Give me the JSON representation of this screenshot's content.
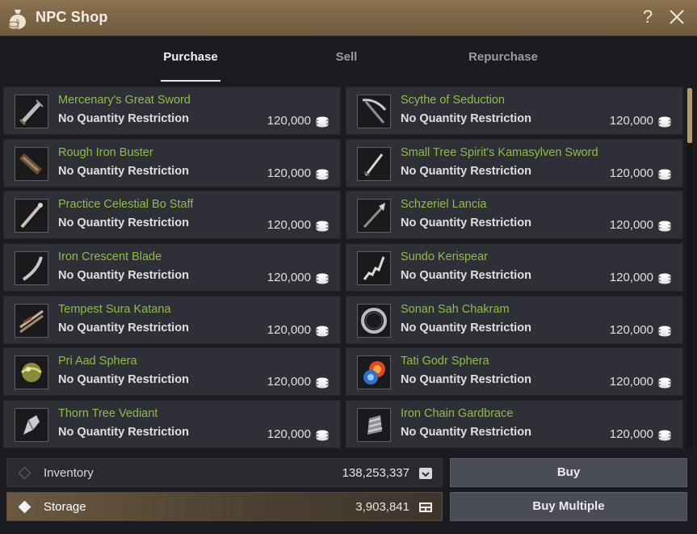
{
  "window": {
    "title": "NPC Shop",
    "help_label": "?"
  },
  "tabs": [
    {
      "label": "Purchase",
      "active": true
    },
    {
      "label": "Sell",
      "active": false
    },
    {
      "label": "Repurchase",
      "active": false
    }
  ],
  "items": [
    {
      "name": "Mercenary's Great Sword",
      "restriction": "No Quantity Restriction",
      "price": "120,000",
      "icon": "great-sword-icon"
    },
    {
      "name": "Scythe of Seduction",
      "restriction": "No Quantity Restriction",
      "price": "120,000",
      "icon": "scythe-icon"
    },
    {
      "name": "Rough Iron Buster",
      "restriction": "No Quantity Restriction",
      "price": "120,000",
      "icon": "buster-icon"
    },
    {
      "name": "Small Tree Spirit's Kamasylven Sword",
      "restriction": "No Quantity Restriction",
      "price": "120,000",
      "icon": "kamasylven-sword-icon"
    },
    {
      "name": "Practice Celestial Bo Staff",
      "restriction": "No Quantity Restriction",
      "price": "120,000",
      "icon": "bo-staff-icon"
    },
    {
      "name": "Schzeriel Lancia",
      "restriction": "No Quantity Restriction",
      "price": "120,000",
      "icon": "lancia-icon"
    },
    {
      "name": "Iron Crescent Blade",
      "restriction": "No Quantity Restriction",
      "price": "120,000",
      "icon": "crescent-blade-icon"
    },
    {
      "name": "Sundo Kerispear",
      "restriction": "No Quantity Restriction",
      "price": "120,000",
      "icon": "kerispear-icon"
    },
    {
      "name": "Tempest Sura Katana",
      "restriction": "No Quantity Restriction",
      "price": "120,000",
      "icon": "katana-icon"
    },
    {
      "name": "Sonan Sah Chakram",
      "restriction": "No Quantity Restriction",
      "price": "120,000",
      "icon": "chakram-icon"
    },
    {
      "name": "Pri Aad Sphera",
      "restriction": "No Quantity Restriction",
      "price": "120,000",
      "icon": "sphera-icon"
    },
    {
      "name": "Tati Godr Sphera",
      "restriction": "No Quantity Restriction",
      "price": "120,000",
      "icon": "fire-sphera-icon"
    },
    {
      "name": "Thorn Tree Vediant",
      "restriction": "No Quantity Restriction",
      "price": "120,000",
      "icon": "vediant-icon"
    },
    {
      "name": "Iron Chain Gardbrace",
      "restriction": "No Quantity Restriction",
      "price": "120,000",
      "icon": "gardbrace-icon"
    }
  ],
  "currency_icon": "silver-coin-stack-icon",
  "inventory": {
    "label": "Inventory",
    "amount": "138,253,337",
    "icon": "inventory-icon",
    "selected": false
  },
  "storage": {
    "label": "Storage",
    "amount": "3,903,841",
    "icon": "storage-icon",
    "selected": true
  },
  "buttons": {
    "buy": "Buy",
    "buy_multiple": "Buy Multiple"
  },
  "colors": {
    "title_bar": "#7d6748",
    "item_name": "#8fbd4a",
    "panel": "#2e2f37",
    "scroll_thumb": "#b79a6a"
  }
}
